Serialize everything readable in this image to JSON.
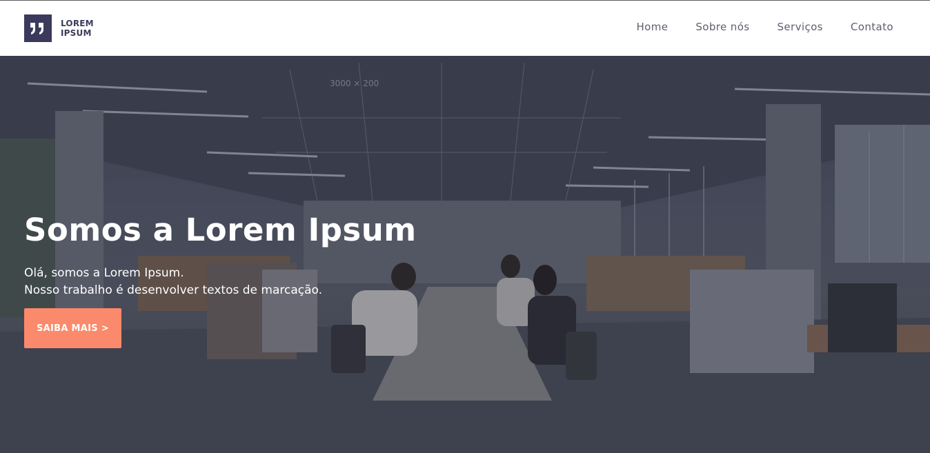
{
  "header": {
    "logo": {
      "line1": "LOREM",
      "line2": "IPSUM",
      "icon": "quote-icon"
    },
    "nav": [
      {
        "label": "Home"
      },
      {
        "label": "Sobre nós"
      },
      {
        "label": "Serviços"
      },
      {
        "label": "Contato"
      }
    ]
  },
  "hero": {
    "title": "Somos a Lorem Ipsum",
    "subtitle_line1": "Olá, somos a Lorem Ipsum.",
    "subtitle_line2": "Nosso trabalho é desenvolver textos de marcação.",
    "cta_label": "SAIBA MAIS >",
    "background_image": "office-photo",
    "ceiling_sign": "3000 × 200"
  },
  "colors": {
    "brand": "#3b3a5c",
    "accent": "#fa8a6b",
    "nav_text": "#5c5f6c",
    "hero_text": "#ffffff"
  }
}
